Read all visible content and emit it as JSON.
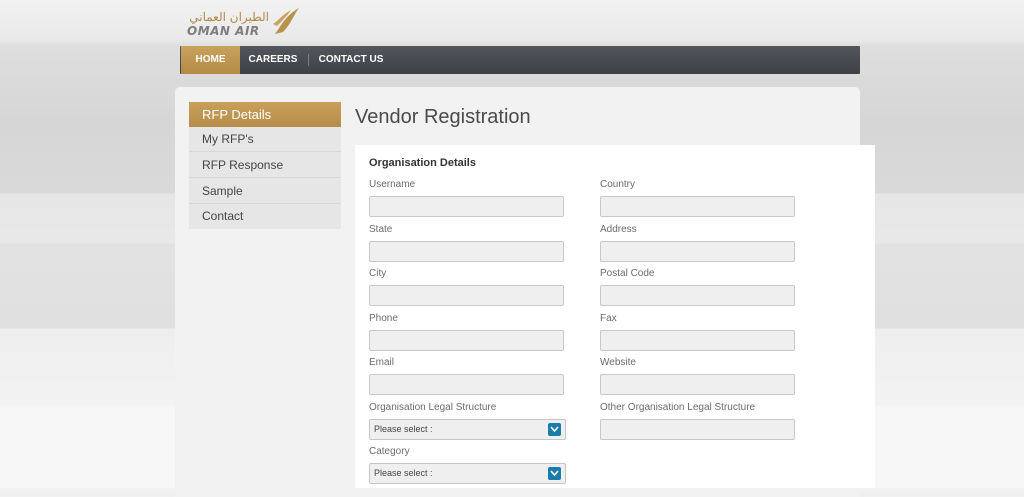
{
  "brand": {
    "arabic": "الطيران العماني",
    "english": "OMAN AIR",
    "brand_color": "#b8924c"
  },
  "nav": {
    "items": [
      {
        "label": "HOME",
        "active": true
      },
      {
        "label": "CAREERS",
        "active": false
      },
      {
        "label": "CONTACT US",
        "active": false
      }
    ]
  },
  "sidebar": {
    "items": [
      {
        "label": "RFP Details",
        "active": true
      },
      {
        "label": "My RFP's",
        "active": false
      },
      {
        "label": "RFP Response",
        "active": false
      },
      {
        "label": "Sample",
        "active": false
      },
      {
        "label": "Contact",
        "active": false
      }
    ]
  },
  "page": {
    "title": "Vendor Registration"
  },
  "form": {
    "section_title": "Organisation Details",
    "fields": {
      "username": {
        "label": "Username",
        "value": ""
      },
      "country": {
        "label": "Country",
        "value": ""
      },
      "state": {
        "label": "State",
        "value": ""
      },
      "address": {
        "label": "Address",
        "value": ""
      },
      "city": {
        "label": "City",
        "value": ""
      },
      "postal_code": {
        "label": "Postal Code",
        "value": ""
      },
      "phone": {
        "label": "Phone",
        "value": ""
      },
      "fax": {
        "label": "Fax",
        "value": ""
      },
      "email": {
        "label": "Email",
        "value": ""
      },
      "website": {
        "label": "Website",
        "value": ""
      },
      "legal_structure": {
        "label": "Organisation Legal Structure",
        "selected": "Please select :"
      },
      "other_legal_structure": {
        "label": "Other Organisation Legal Structure",
        "value": ""
      },
      "category": {
        "label": "Category",
        "selected": "Please select :"
      }
    }
  },
  "colors": {
    "accent": "#b8924c",
    "nav_bg": "#45484d",
    "select_arrow": "#1a7ca8"
  }
}
